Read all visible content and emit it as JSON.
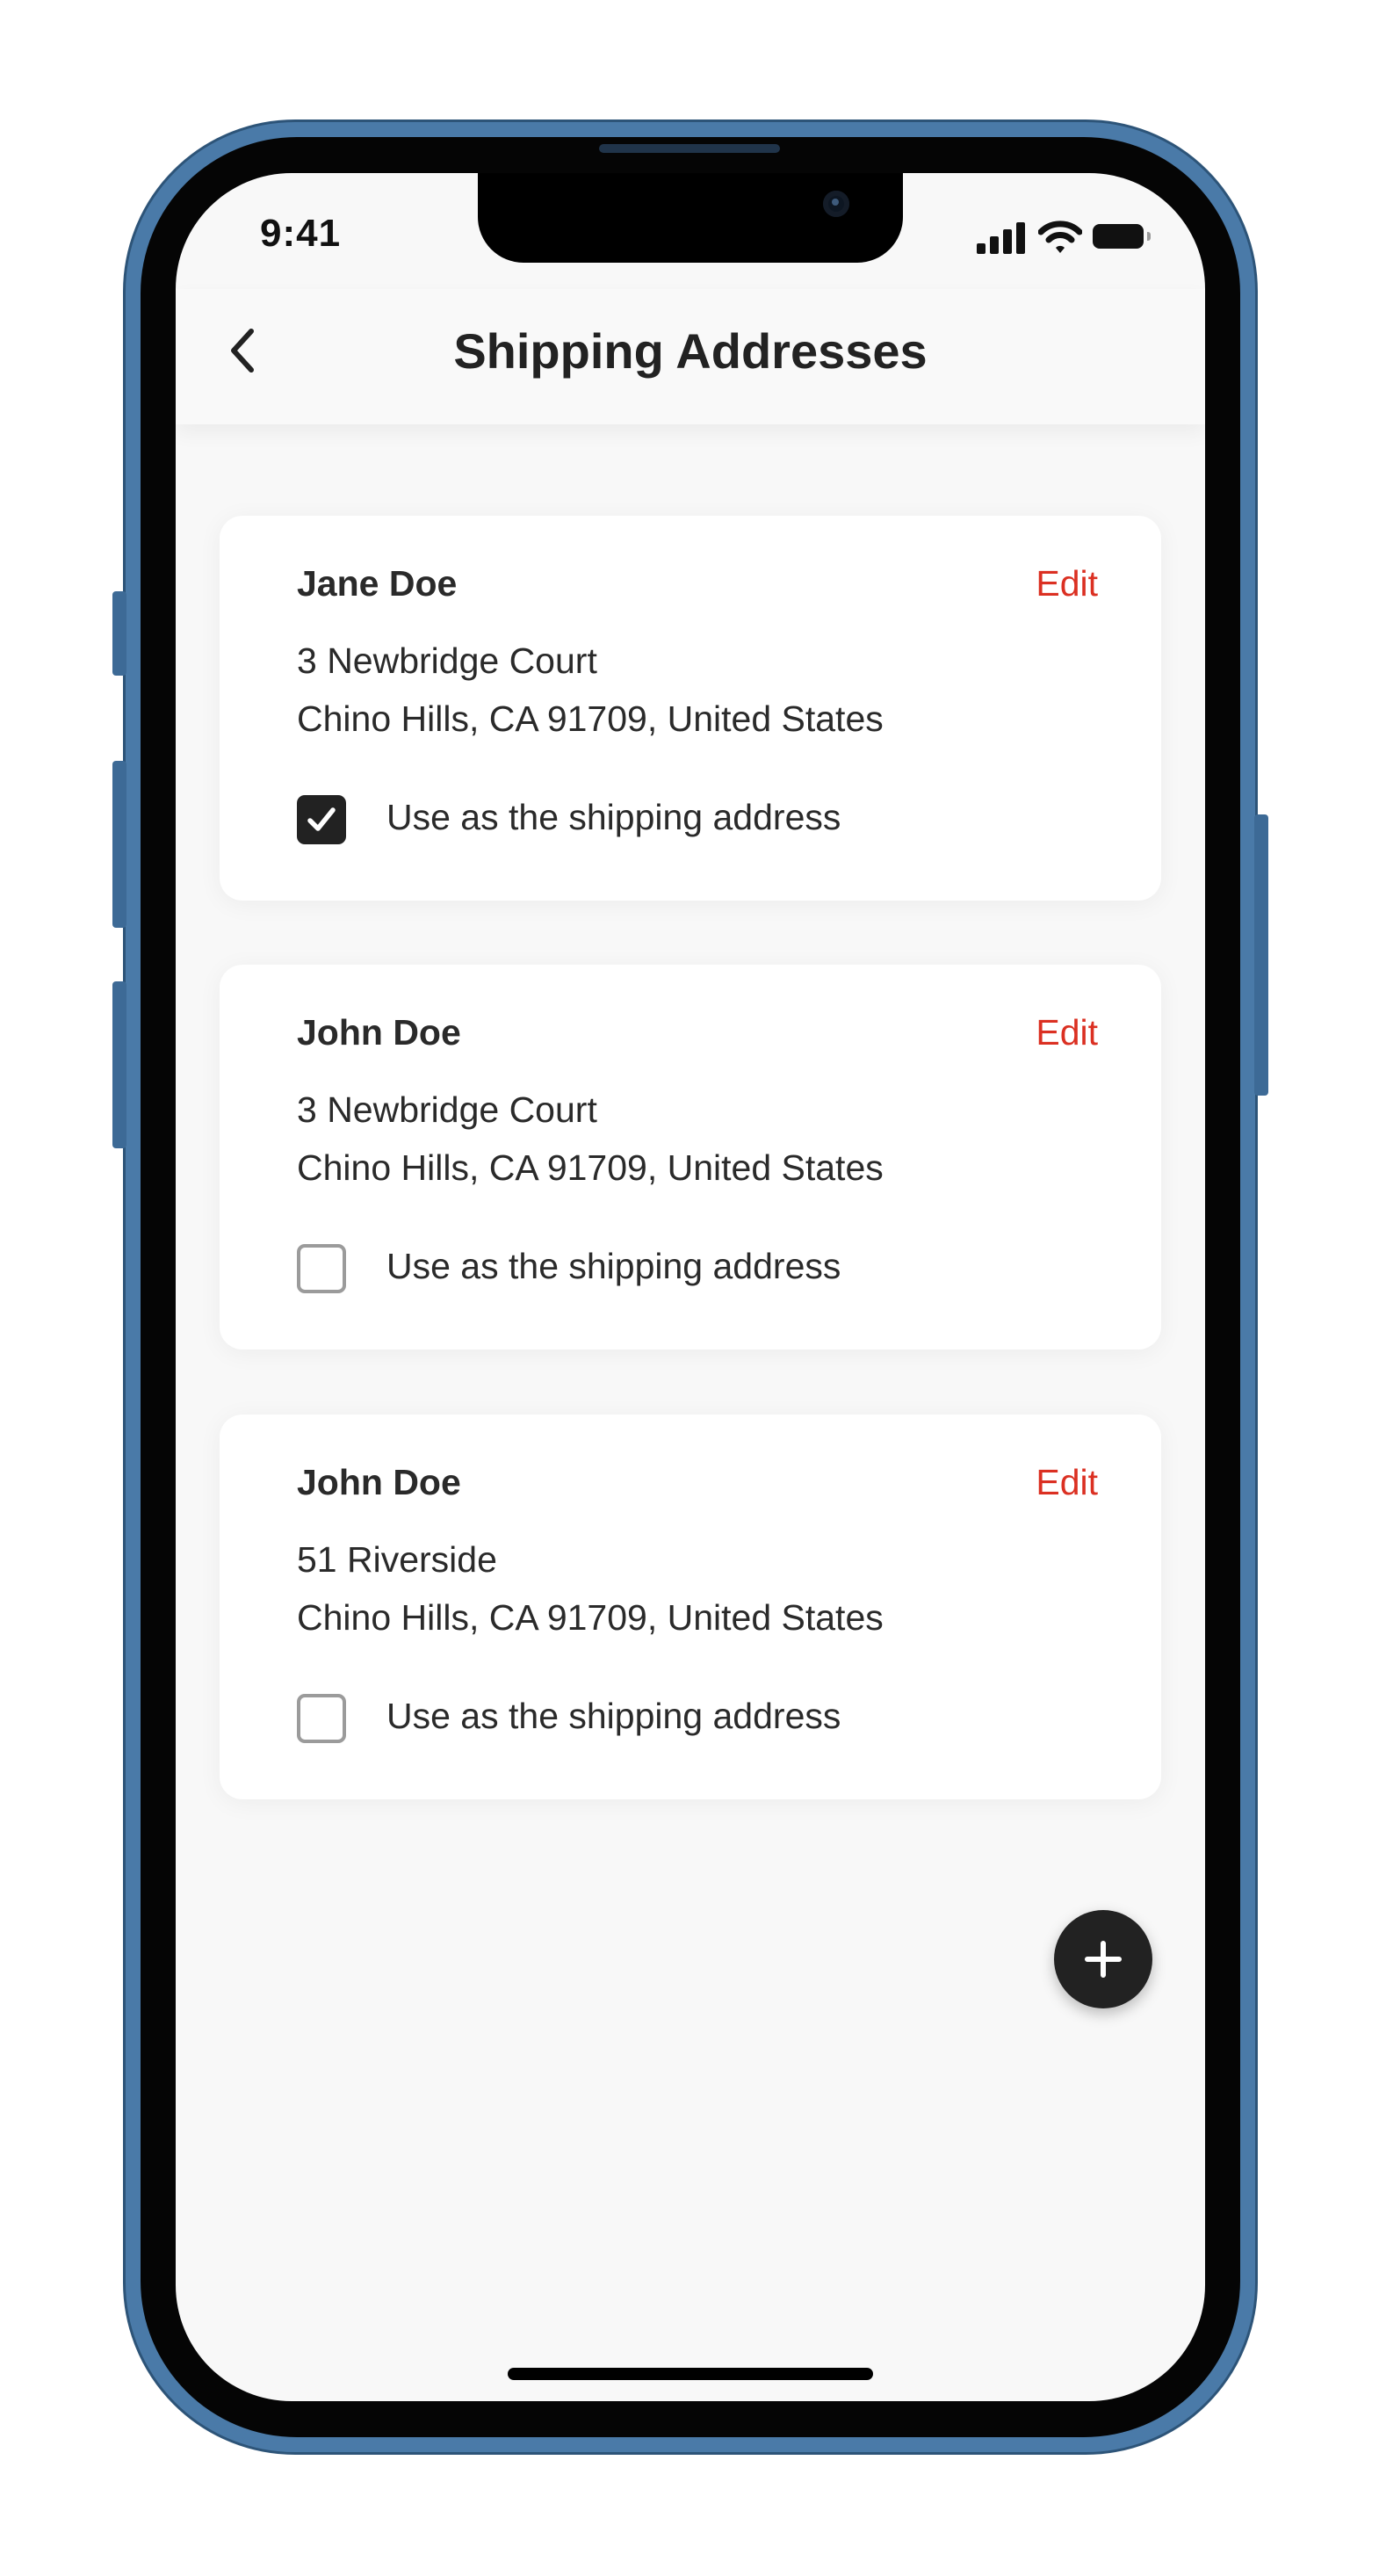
{
  "status_bar": {
    "time": "9:41"
  },
  "header": {
    "title": "Shipping Addresses",
    "back_icon": "chevron-left-icon"
  },
  "addresses": [
    {
      "name": "Jane Doe",
      "edit_label": "Edit",
      "line1": "3 Newbridge Court",
      "line2": "Chino Hills, CA 91709, United States",
      "checkbox_label": "Use as the shipping address",
      "selected": true
    },
    {
      "name": "John Doe",
      "edit_label": "Edit",
      "line1": "3 Newbridge Court",
      "line2": "Chino Hills, CA 91709, United States",
      "checkbox_label": "Use as the shipping address",
      "selected": false
    },
    {
      "name": "John Doe",
      "edit_label": "Edit",
      "line1": "51 Riverside",
      "line2": "Chino Hills, CA 91709, United States",
      "checkbox_label": "Use as the shipping address",
      "selected": false
    }
  ],
  "fab": {
    "icon": "plus-icon"
  },
  "colors": {
    "accent": "#DB3022",
    "dark": "#222222",
    "background": "#F9F9F9",
    "card": "#FFFFFF"
  }
}
